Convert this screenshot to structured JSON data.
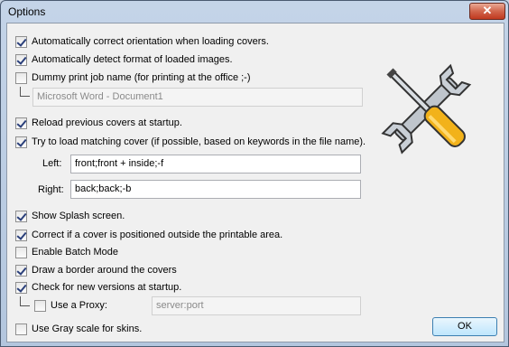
{
  "window": {
    "title": "Options",
    "close_glyph": "✕"
  },
  "options": {
    "auto_orientation": {
      "label": "Automatically correct orientation when loading  covers.",
      "checked": true
    },
    "auto_format": {
      "label": "Automatically detect format of loaded images.",
      "checked": true
    },
    "dummy_print": {
      "label": "Dummy print job name (for printing at the office ;-)",
      "checked": false,
      "value": "Microsoft Word - Document1"
    },
    "reload_covers": {
      "label": "Reload previous covers at startup.",
      "checked": true
    },
    "load_matching": {
      "label": "Try to load matching cover (if possible, based on keywords in the file name).",
      "checked": true,
      "left_label": "Left:",
      "left_value": "front;front + inside;-f",
      "right_label": "Right:",
      "right_value": "back;back;-b"
    },
    "splash": {
      "label": "Show Splash screen.",
      "checked": true
    },
    "correct_position": {
      "label": "Correct if a cover is positioned outside the printable area.",
      "checked": true
    },
    "batch_mode": {
      "label": "Enable Batch Mode",
      "checked": false
    },
    "draw_border": {
      "label": "Draw a border around the covers",
      "checked": true
    },
    "check_versions": {
      "label": "Check for new versions at startup.",
      "checked": true
    },
    "use_proxy": {
      "label": "Use a Proxy:",
      "checked": false,
      "placeholder": "server:port"
    },
    "gray_scale": {
      "label": "Use Gray scale for skins.",
      "checked": false
    }
  },
  "buttons": {
    "ok": "OK"
  },
  "icons": {
    "tools": "wrench-screwdriver-icon"
  }
}
